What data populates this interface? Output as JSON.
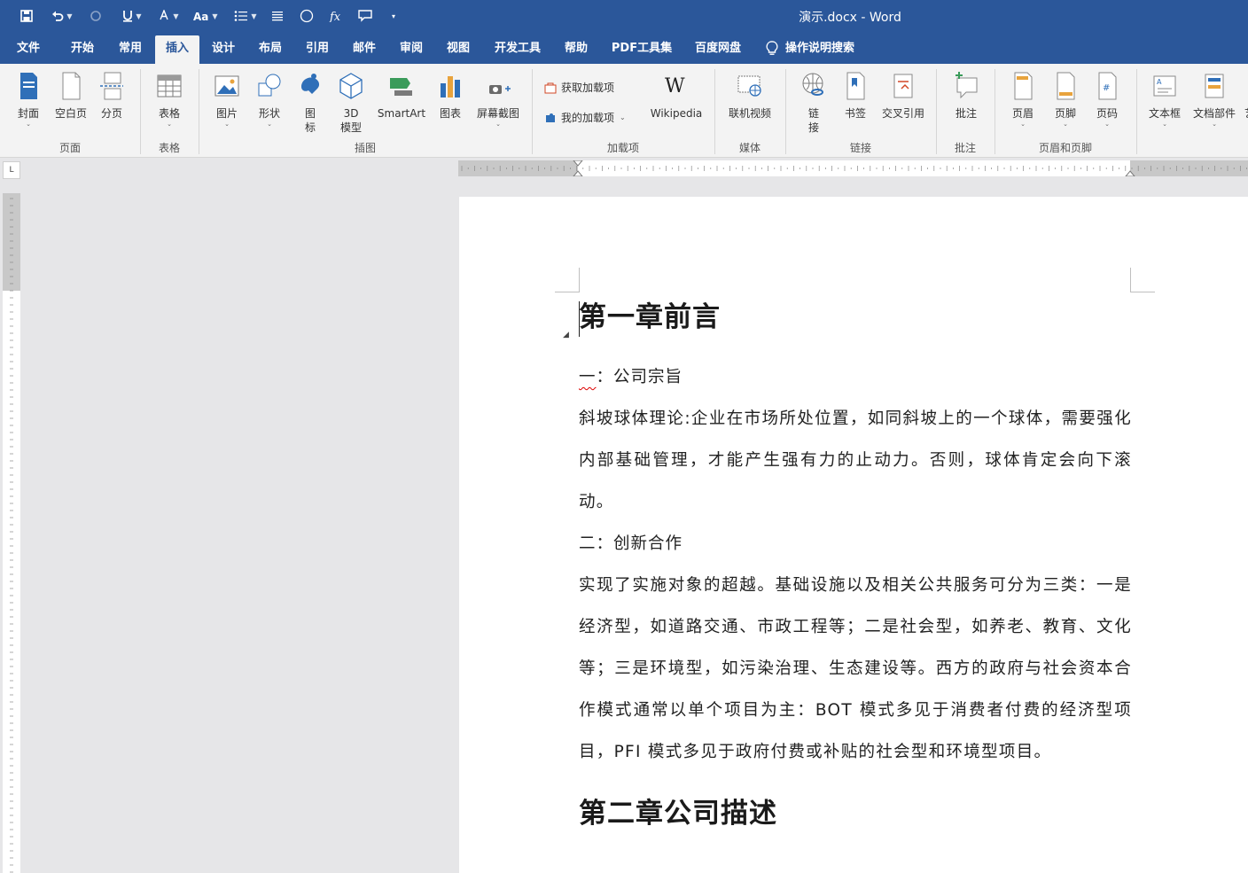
{
  "window": {
    "title": "演示.docx  -  Word"
  },
  "tabs": [
    {
      "label": "文件"
    },
    {
      "label": "开始"
    },
    {
      "label": "常用"
    },
    {
      "label": "插入"
    },
    {
      "label": "设计"
    },
    {
      "label": "布局"
    },
    {
      "label": "引用"
    },
    {
      "label": "邮件"
    },
    {
      "label": "审阅"
    },
    {
      "label": "视图"
    },
    {
      "label": "开发工具"
    },
    {
      "label": "帮助"
    },
    {
      "label": "PDF工具集"
    },
    {
      "label": "百度网盘"
    }
  ],
  "active_tab": "插入",
  "tell_me": "操作说明搜索",
  "ribbon": {
    "pages": {
      "cover": "封面",
      "blank": "空白页",
      "break": "分页",
      "group": "页面"
    },
    "tables": {
      "table": "表格",
      "group": "表格"
    },
    "illustrations": {
      "picture": "图片",
      "shapes": "形状",
      "icons_1": "图",
      "icons_2": "标",
      "model_1": "3D",
      "model_2": "模型",
      "smartart": "SmartArt",
      "chart": "图表",
      "screenshot": "屏幕截图",
      "group": "插图"
    },
    "addins": {
      "get": "获取加载项",
      "mine": "我的加载项",
      "wikipedia": "Wikipedia",
      "group": "加载项"
    },
    "media": {
      "video": "联机视频",
      "group": "媒体"
    },
    "links": {
      "link_1": "链",
      "link_2": "接",
      "bookmark": "书签",
      "crossref": "交叉引用",
      "group": "链接"
    },
    "comments": {
      "comment": "批注",
      "group": "批注"
    },
    "header_footer": {
      "header": "页眉",
      "footer": "页脚",
      "page_number": "页码",
      "group": "页眉和页脚"
    },
    "text": {
      "textbox": "文本框",
      "quickparts": "文档部件",
      "overflow": "艺"
    }
  },
  "document": {
    "heading1": "第一章前言",
    "sub1_prefix": "一",
    "sub1_rest": "：公司宗旨",
    "para1": "斜坡球体理论:企业在市场所处位置，如同斜坡上的一个球体，需要强化内部基础管理，才能产生强有力的止动力。否则，球体肯定会向下滚动。",
    "sub2": "二：创新合作",
    "para2": "实现了实施对象的超越。基础设施以及相关公共服务可分为三类：一是经济型，如道路交通、市政工程等；二是社会型，如养老、教育、文化等；三是环境型，如污染治理、生态建设等。西方的政府与社会资本合作模式通常以单个项目为主：BOT 模式多见于消费者付费的经济型项目，PFI 模式多见于政府付费或补贴的社会型和环境型项目。",
    "heading2": "第二章公司描述"
  },
  "ruler": {
    "tab_selector": "L"
  }
}
